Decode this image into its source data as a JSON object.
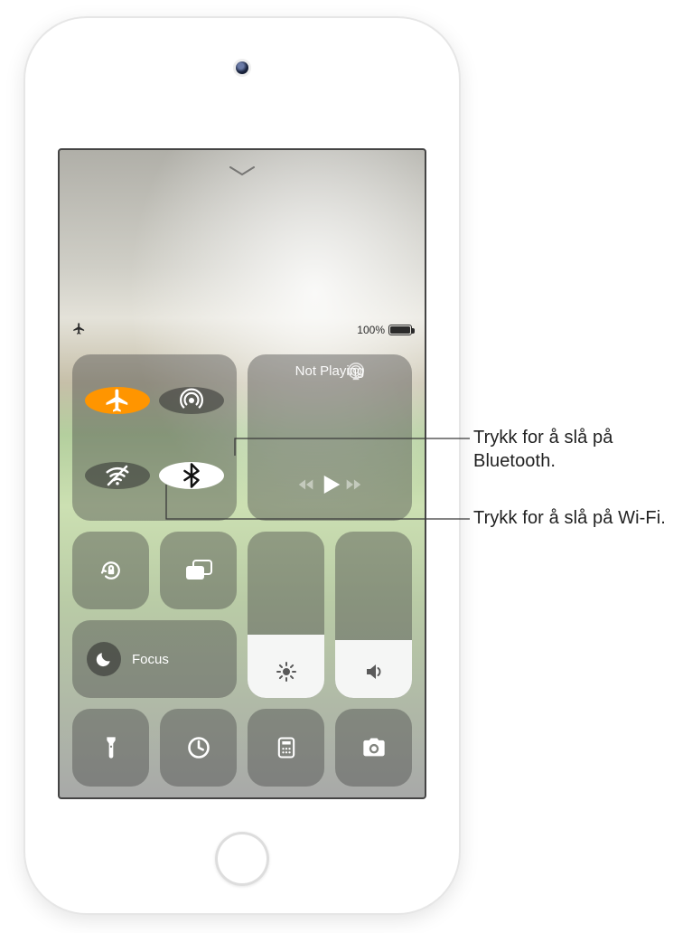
{
  "status": {
    "battery_text": "100%"
  },
  "media": {
    "title": "Not Playing"
  },
  "focus": {
    "label": "Focus"
  },
  "sliders": {
    "brightness_pct": 38,
    "volume_pct": 35
  },
  "callouts": {
    "bluetooth": "Trykk for å slå på Bluetooth.",
    "wifi": "Trykk for å slå på Wi-Fi."
  },
  "colors": {
    "airplane_on": "#ff9500",
    "module_bg": "rgba(70,70,70,0.42)"
  }
}
